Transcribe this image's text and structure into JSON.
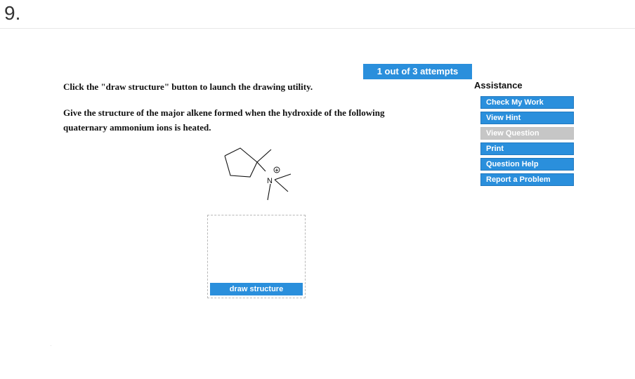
{
  "question": {
    "number": "9.",
    "attempts": "1 out of 3 attempts",
    "instruction": "Click the \"draw structure\" button to launch the drawing utility.",
    "prompt": "Give the structure of the major alkene formed when the hydroxide of the following quaternary ammonium ions is heated.",
    "molecule": {
      "atom_label": "N",
      "charge_symbol": "+"
    },
    "draw_button_label": "draw structure"
  },
  "assistance": {
    "title": "Assistance",
    "items": [
      {
        "label": "Check My Work",
        "enabled": true
      },
      {
        "label": "View Hint",
        "enabled": true
      },
      {
        "label": "View Question",
        "enabled": false
      },
      {
        "label": "Print",
        "enabled": true
      },
      {
        "label": "Question Help",
        "enabled": true
      },
      {
        "label": "Report a Problem",
        "enabled": true
      }
    ]
  },
  "colors": {
    "accent": "#2a8fdc",
    "disabled": "#c6c6c6"
  }
}
